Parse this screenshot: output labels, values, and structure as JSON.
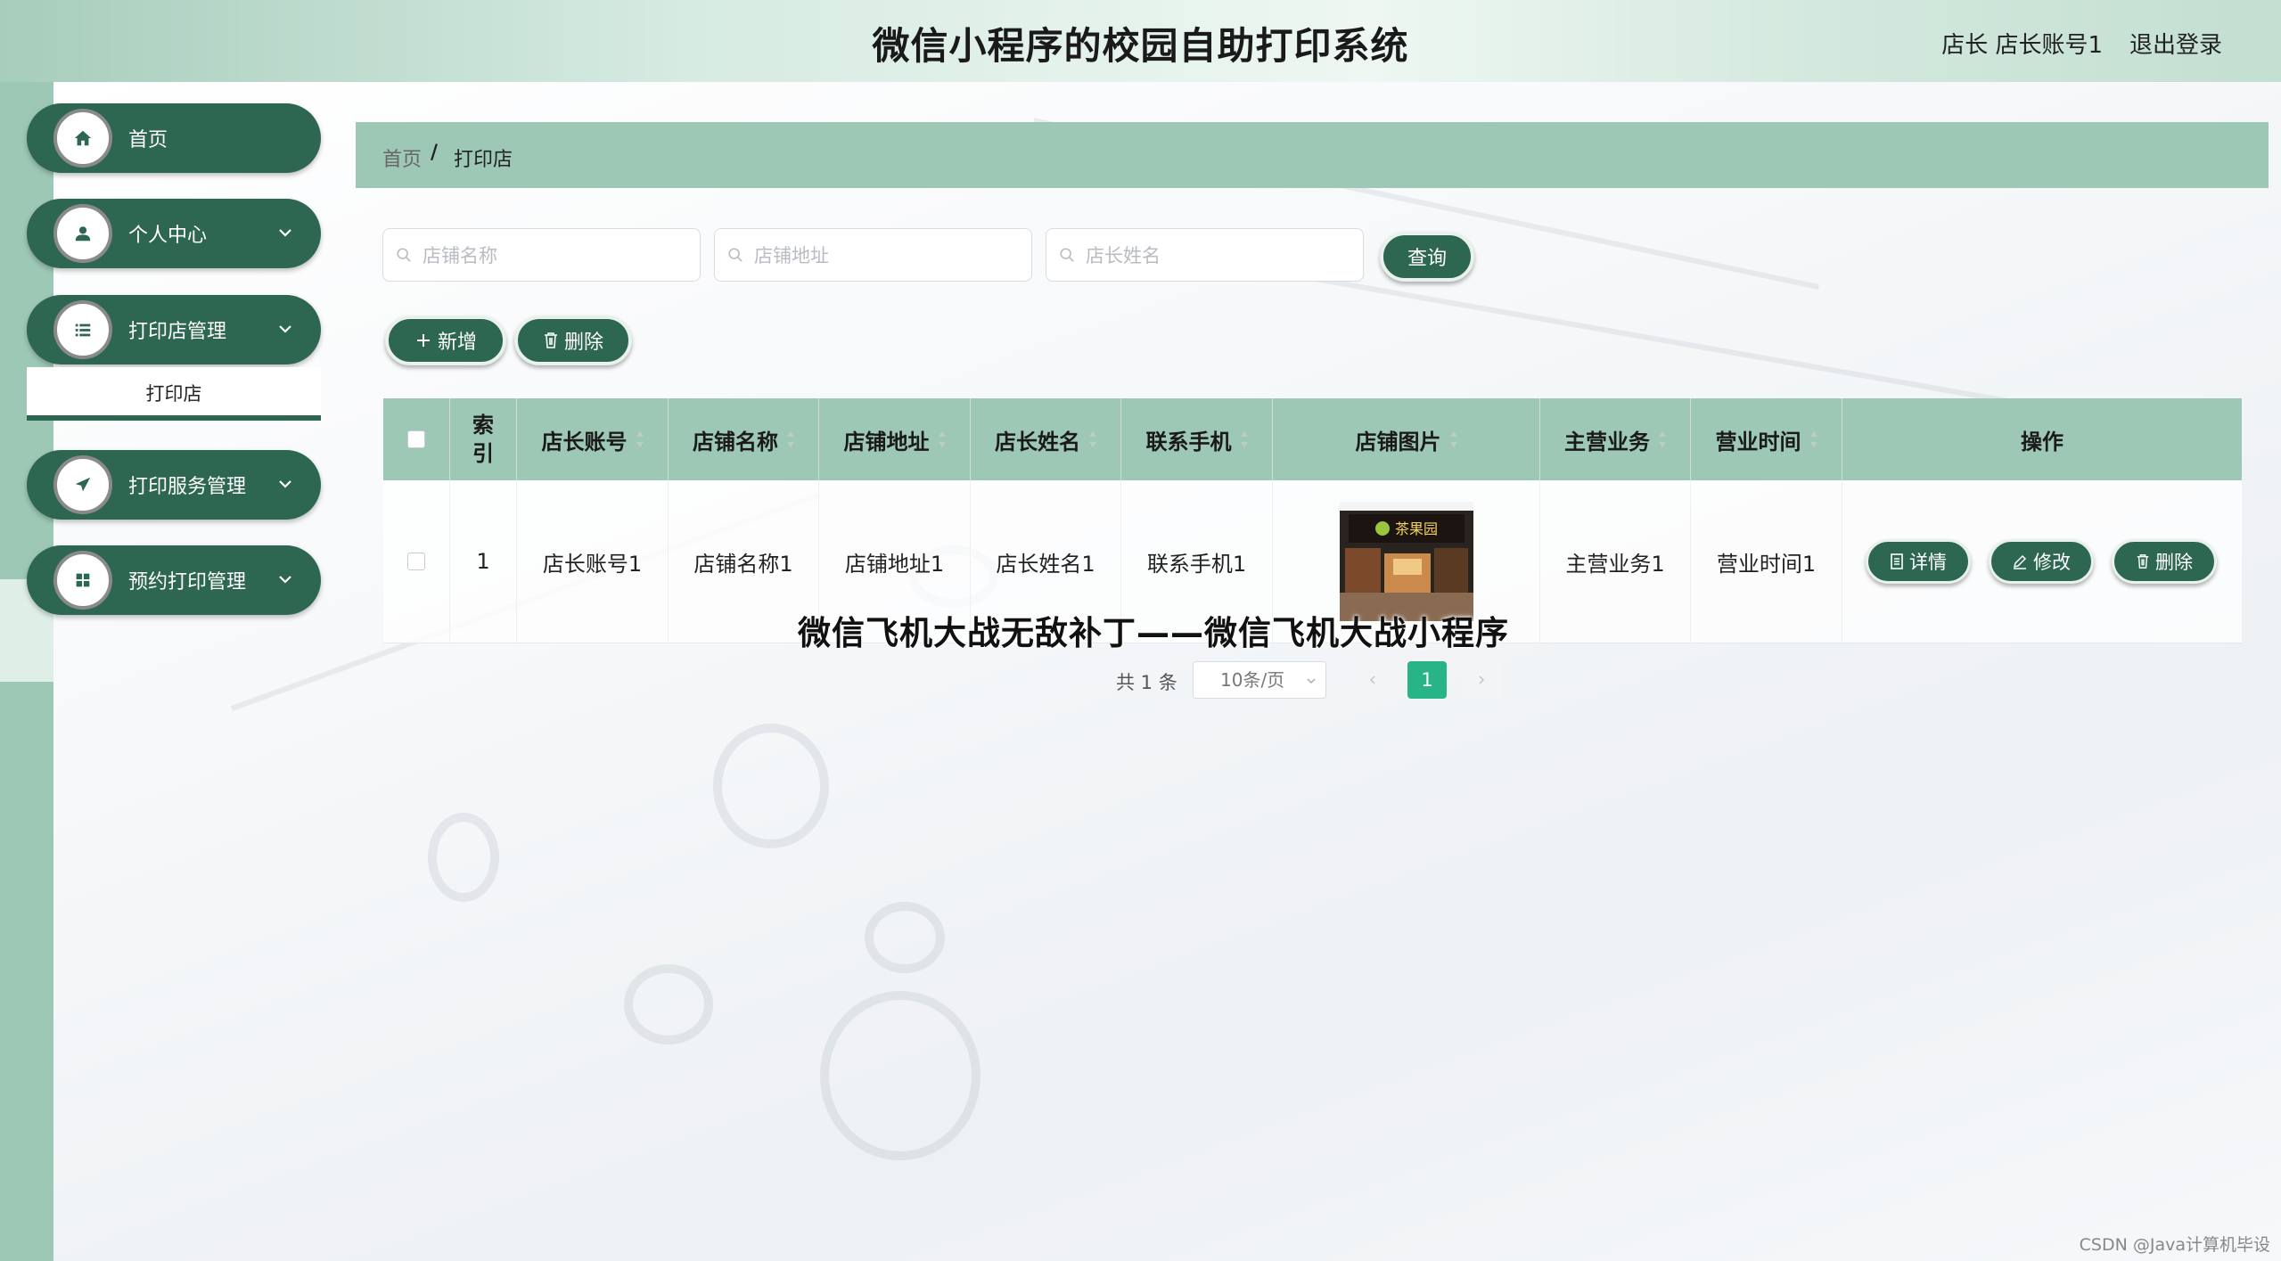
{
  "header": {
    "title": "微信小程序的校园自助打印系统",
    "user_label": "店长 店长账号1",
    "logout_label": "退出登录"
  },
  "sidebar": {
    "items": [
      {
        "label": "首页",
        "icon": "home-icon"
      },
      {
        "label": "个人中心",
        "icon": "user-icon"
      },
      {
        "label": "打印店管理",
        "icon": "list-icon"
      },
      {
        "label": "打印服务管理",
        "icon": "send-icon"
      },
      {
        "label": "预约打印管理",
        "icon": "grid-icon"
      }
    ],
    "sub_item": "打印店"
  },
  "breadcrumb": {
    "home": "首页",
    "separator": "/",
    "current": "打印店"
  },
  "search": {
    "shop_name_placeholder": "店铺名称",
    "shop_address_placeholder": "店铺地址",
    "owner_name_placeholder": "店长姓名",
    "query_label": "查询"
  },
  "actions": {
    "add_label": "新增",
    "delete_label": "删除"
  },
  "table": {
    "headers": [
      "索引",
      "店长账号",
      "店铺名称",
      "店铺地址",
      "店长姓名",
      "联系手机",
      "店铺图片",
      "主营业务",
      "营业时间",
      "操作"
    ],
    "rows": [
      {
        "index": "1",
        "account": "店长账号1",
        "shop_name": "店铺名称1",
        "address": "店铺地址1",
        "owner": "店长姓名1",
        "phone": "联系手机1",
        "image_sign": "茶果园",
        "business": "主营业务1",
        "hours": "营业时间1"
      }
    ],
    "row_actions": {
      "detail": "详情",
      "edit": "修改",
      "delete": "删除"
    }
  },
  "pagination": {
    "total": "共 1 条",
    "page_size": "10条/页",
    "current_page": "1"
  },
  "overlay_title": "微信飞机大战无敌补丁——微信飞机大战小程序",
  "watermark": "CSDN @Java计算机毕设",
  "colors": {
    "primary": "#2d6651",
    "accent": "#9ec8b6",
    "page_active": "#28b487"
  }
}
